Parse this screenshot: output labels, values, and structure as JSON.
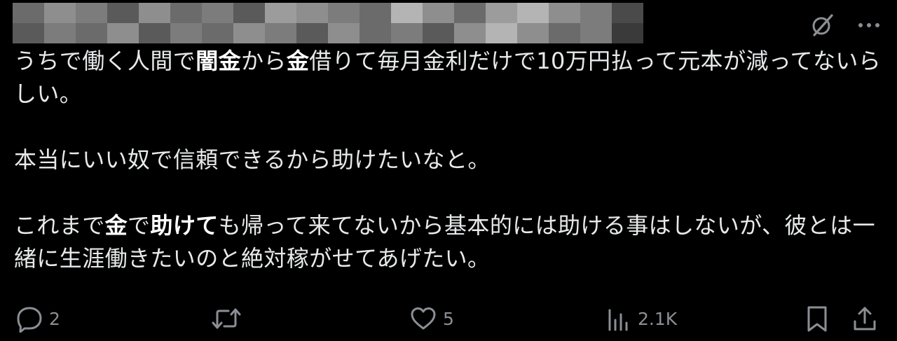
{
  "header": {
    "author_name_blurred": true,
    "grok_icon": "grok-slash-circle-icon",
    "more_icon": "more-dots-icon"
  },
  "tweet": {
    "paragraphs": [
      [
        {
          "text": "うちで働く人間で",
          "bold": false
        },
        {
          "text": "闇金",
          "bold": true
        },
        {
          "text": "から",
          "bold": false
        },
        {
          "text": "金",
          "bold": true
        },
        {
          "text": "借りて毎月金利だけで10万円払って元本が減ってないらしい。",
          "bold": false
        }
      ],
      [],
      [
        {
          "text": "本当にいい奴で信頼できるから助けたいなと。",
          "bold": false
        }
      ],
      [],
      [
        {
          "text": "これまで",
          "bold": false
        },
        {
          "text": "金",
          "bold": true
        },
        {
          "text": "で",
          "bold": false
        },
        {
          "text": "助けて",
          "bold": true
        },
        {
          "text": "も帰って来てないから基本的には助ける事はしないが、彼とは一緒に生涯働きたいのと絶対稼がせてあげたい。",
          "bold": false
        }
      ]
    ]
  },
  "actions": {
    "reply": {
      "icon": "reply-bubble-icon",
      "count": "2"
    },
    "repost": {
      "icon": "repost-arrows-icon",
      "count": ""
    },
    "like": {
      "icon": "heart-icon",
      "count": "5"
    },
    "views": {
      "icon": "views-bar-chart-icon",
      "count": "2.1K"
    },
    "bookmark": {
      "icon": "bookmark-icon"
    },
    "share": {
      "icon": "share-upload-icon"
    }
  },
  "colors": {
    "background": "#000000",
    "text": "#e7e9ea",
    "muted": "#8b8f94"
  }
}
